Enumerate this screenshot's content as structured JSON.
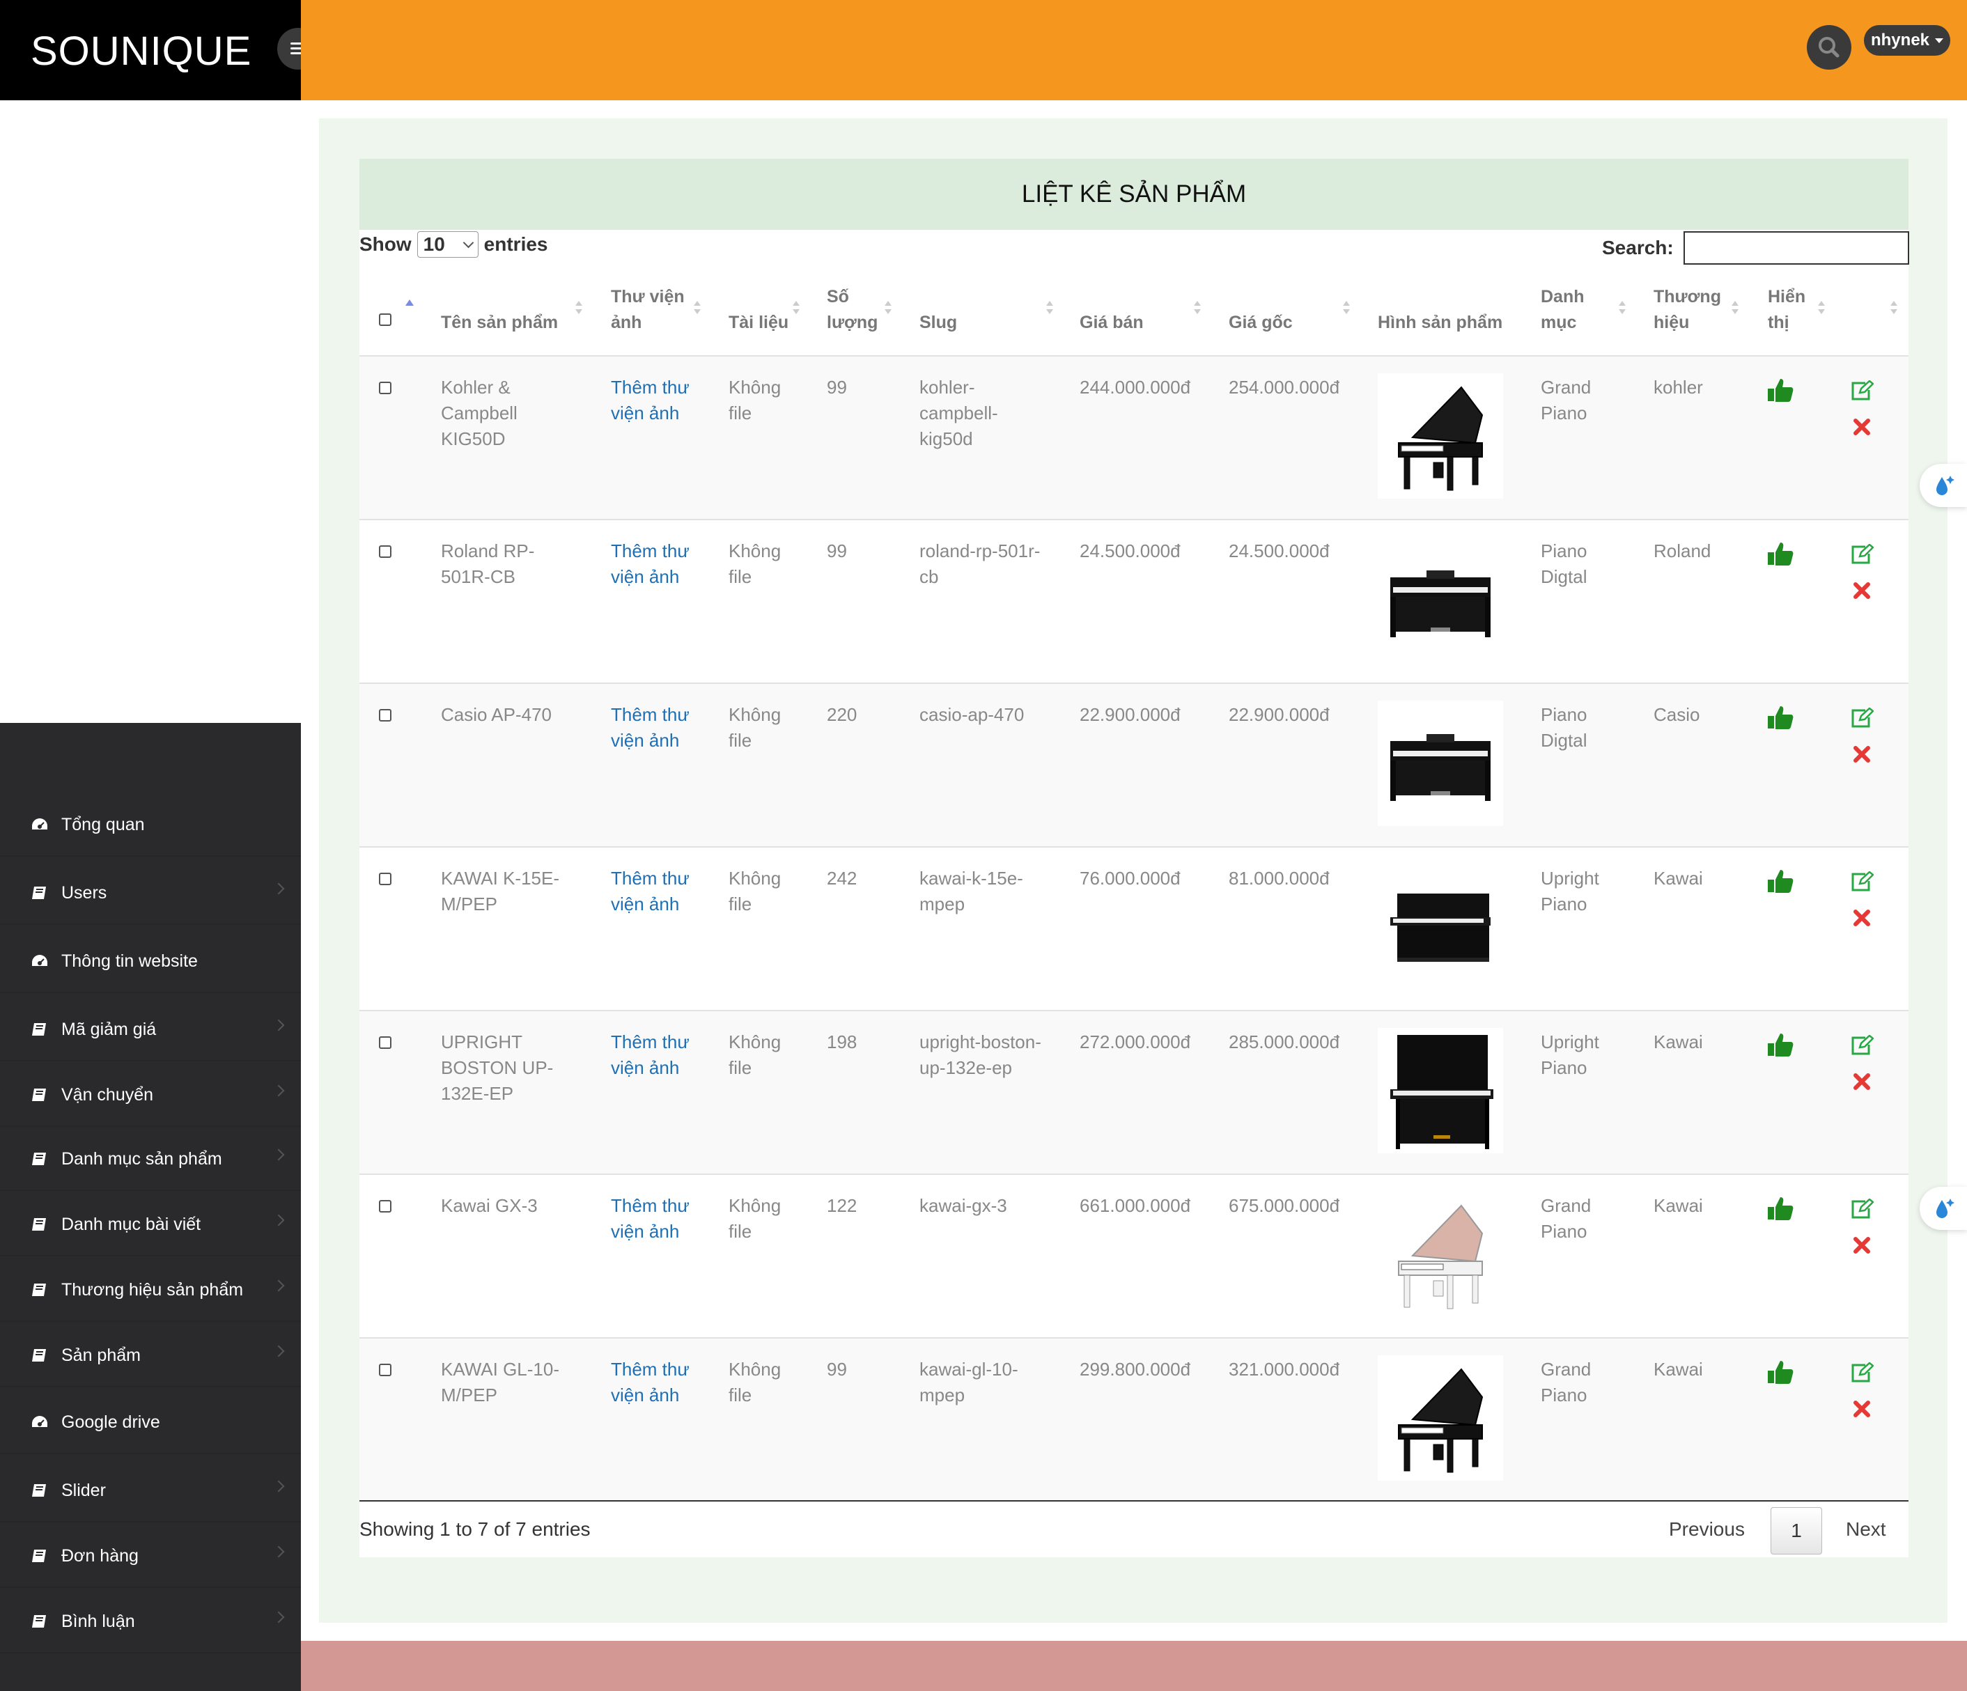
{
  "brand": {
    "name": "SOUNIQUE"
  },
  "user": {
    "name": "nhynek"
  },
  "icons": {
    "menu": "hamburger-icon",
    "search": "search-icon",
    "user_caret": "caret-down-icon",
    "nav": "book-icon",
    "nav_dashboard": "dashboard-icon",
    "show": "thumbs-up-icon",
    "edit": "edit-icon",
    "delete": "close-icon",
    "float": "water-drop-icon"
  },
  "colors": {
    "topbar": "#f5971f",
    "brand_bg": "#000000",
    "sidebar": "#2a2a2c",
    "header_bg": "#dcecdc",
    "link": "#1f6fb5",
    "thumbs": "#1f8a1f",
    "edit": "#28a745",
    "delete": "#e53935",
    "footer": "#d49894"
  },
  "sidebar": {
    "items": [
      {
        "label": "Tổng quan"
      },
      {
        "label": "Users"
      },
      {
        "label": "Thông tin website"
      },
      {
        "label": "Mã giảm giá"
      },
      {
        "label": "Vận chuyển"
      },
      {
        "label": "Danh mục sản phẩm"
      },
      {
        "label": "Danh mục bài viết"
      },
      {
        "label": "Thương hiệu sản phẩm"
      },
      {
        "label": "Sản phẩm"
      },
      {
        "label": "Google drive"
      },
      {
        "label": "Slider"
      },
      {
        "label": "Đơn hàng"
      },
      {
        "label": "Bình luận"
      }
    ]
  },
  "panel": {
    "title": "LIỆT KÊ SẢN PHẨM",
    "show_label": "Show",
    "show_value": "10",
    "entries_label": "entries",
    "search_label": "Search:",
    "search_value": ""
  },
  "table": {
    "columns": {
      "name": "Tên sản phẩm",
      "gallery_1": "Thư viện",
      "gallery_2": "ảnh",
      "doc": "Tài liệu",
      "qty_1": "Số",
      "qty_2": "lượng",
      "slug": "Slug",
      "price": "Giá bán",
      "cost": "Giá gốc",
      "image": "Hình sản phẩm",
      "category_1": "Danh",
      "category_2": "mục",
      "brand_1": "Thương",
      "brand_2": "hiệu",
      "visible_1": "Hiển",
      "visible_2": "thị"
    },
    "rows": [
      {
        "name": [
          "Kohler &",
          "Campbell",
          "KIG50D"
        ],
        "gallery": [
          "Thêm thư",
          "viện ảnh"
        ],
        "doc": [
          "Không",
          "file"
        ],
        "qty": "99",
        "slug": [
          "kohler-",
          "campbell-",
          "kig50d"
        ],
        "price": "244.000.000đ",
        "cost": "254.000.000đ",
        "category": [
          "Grand",
          "Piano"
        ],
        "brand": "kohler",
        "image": "grand-piano-black"
      },
      {
        "name": [
          "Roland RP-",
          "501R-CB"
        ],
        "gallery": [
          "Thêm thư",
          "viện ảnh"
        ],
        "doc": [
          "Không",
          "file"
        ],
        "qty": "99",
        "slug": [
          "roland-rp-501r-",
          "cb"
        ],
        "price": "24.500.000đ",
        "cost": "24.500.000đ",
        "category": [
          "Piano",
          "Digtal"
        ],
        "brand": "Roland",
        "image": "digital-piano"
      },
      {
        "name": [
          "Casio AP-470"
        ],
        "gallery": [
          "Thêm thư",
          "viện ảnh"
        ],
        "doc": [
          "Không",
          "file"
        ],
        "qty": "220",
        "slug": [
          "casio-ap-470"
        ],
        "price": "22.900.000đ",
        "cost": "22.900.000đ",
        "category": [
          "Piano",
          "Digtal"
        ],
        "brand": "Casio",
        "image": "digital-piano"
      },
      {
        "name": [
          "KAWAI K-15E-",
          "M/PEP"
        ],
        "gallery": [
          "Thêm thư",
          "viện ảnh"
        ],
        "doc": [
          "Không",
          "file"
        ],
        "qty": "242",
        "slug": [
          "kawai-k-15e-",
          "mpep"
        ],
        "price": "76.000.000đ",
        "cost": "81.000.000đ",
        "category": [
          "Upright",
          "Piano"
        ],
        "brand": "Kawai",
        "image": "upright-piano-small"
      },
      {
        "name": [
          "UPRIGHT",
          "BOSTON UP-",
          "132E-EP"
        ],
        "gallery": [
          "Thêm thư",
          "viện ảnh"
        ],
        "doc": [
          "Không",
          "file"
        ],
        "qty": "198",
        "slug": [
          "upright-boston-",
          "up-132e-ep"
        ],
        "price": "272.000.000đ",
        "cost": "285.000.000đ",
        "category": [
          "Upright",
          "Piano"
        ],
        "brand": "Kawai",
        "image": "upright-piano-tall"
      },
      {
        "name": [
          "Kawai GX-3"
        ],
        "gallery": [
          "Thêm thư",
          "viện ảnh"
        ],
        "doc": [
          "Không",
          "file"
        ],
        "qty": "122",
        "slug": [
          "kawai-gx-3"
        ],
        "price": "661.000.000đ",
        "cost": "675.000.000đ",
        "category": [
          "Grand",
          "Piano"
        ],
        "brand": "Kawai",
        "image": "grand-piano-white"
      },
      {
        "name": [
          "KAWAI GL-10-",
          "M/PEP"
        ],
        "gallery": [
          "Thêm thư",
          "viện ảnh"
        ],
        "doc": [
          "Không",
          "file"
        ],
        "qty": "99",
        "slug": [
          "kawai-gl-10-",
          "mpep"
        ],
        "price": "299.800.000đ",
        "cost": "321.000.000đ",
        "category": [
          "Grand",
          "Piano"
        ],
        "brand": "Kawai",
        "image": "grand-piano-black"
      }
    ]
  },
  "footer_info": {
    "text": "Showing 1 to 7 of 7 entries",
    "previous": "Previous",
    "current_page": "1",
    "next": "Next"
  }
}
